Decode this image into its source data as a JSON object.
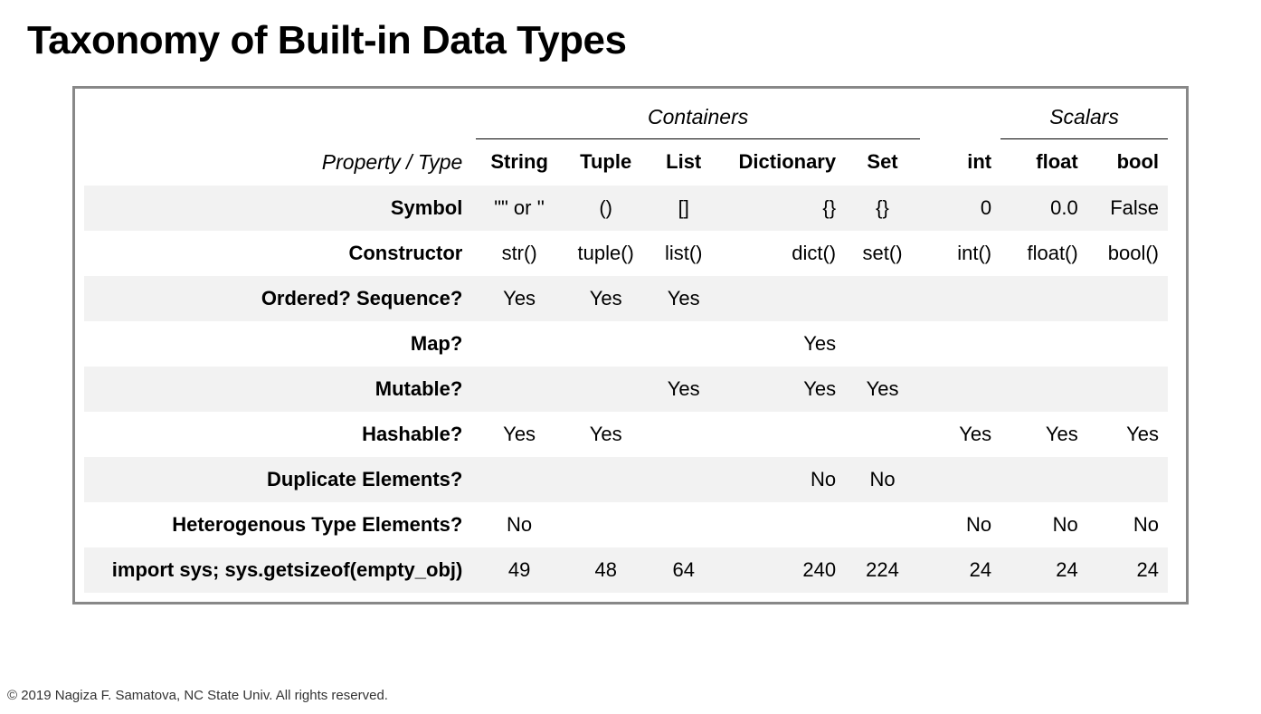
{
  "title": "Taxonomy of Built-in Data Types",
  "superheaders": {
    "containers": "Containers",
    "scalars": "Scalars"
  },
  "colheader": {
    "property": "Property / Type",
    "string": "String",
    "tuple": "Tuple",
    "list": "List",
    "dictionary": "Dictionary",
    "set": "Set",
    "int": "int",
    "float": "float",
    "bool": "bool"
  },
  "rows": [
    {
      "property": "Symbol",
      "string": "\"\" or ''",
      "tuple": "()",
      "list": "[]",
      "dictionary": "{}",
      "set": "{}",
      "int": "0",
      "float": "0.0",
      "bool": "False"
    },
    {
      "property": "Constructor",
      "string": "str()",
      "tuple": "tuple()",
      "list": "list()",
      "dictionary": "dict()",
      "set": "set()",
      "int": "int()",
      "float": "float()",
      "bool": "bool()"
    },
    {
      "property": "Ordered? Sequence?",
      "string": "Yes",
      "tuple": "Yes",
      "list": "Yes",
      "dictionary": "",
      "set": "",
      "int": "",
      "float": "",
      "bool": ""
    },
    {
      "property": "Map?",
      "string": "",
      "tuple": "",
      "list": "",
      "dictionary": "Yes",
      "set": "",
      "int": "",
      "float": "",
      "bool": ""
    },
    {
      "property": "Mutable?",
      "string": "",
      "tuple": "",
      "list": "Yes",
      "dictionary": "Yes",
      "set": "Yes",
      "int": "",
      "float": "",
      "bool": ""
    },
    {
      "property": "Hashable?",
      "string": "Yes",
      "tuple": "Yes",
      "list": "",
      "dictionary": "",
      "set": "",
      "int": "Yes",
      "float": "Yes",
      "bool": "Yes"
    },
    {
      "property": "Duplicate Elements?",
      "string": "",
      "tuple": "",
      "list": "",
      "dictionary": "No",
      "set": "No",
      "int": "",
      "float": "",
      "bool": ""
    },
    {
      "property": "Heterogenous Type Elements?",
      "string": "No",
      "tuple": "",
      "list": "",
      "dictionary": "",
      "set": "",
      "int": "No",
      "float": "No",
      "bool": "No"
    },
    {
      "property": "import sys; sys.getsizeof(empty_obj)",
      "string": "49",
      "tuple": "48",
      "list": "64",
      "dictionary": "240",
      "set": "224",
      "int": "24",
      "float": "24",
      "bool": "24"
    }
  ],
  "footer": "© 2019  Nagiza F. Samatova, NC State Univ. All rights reserved."
}
